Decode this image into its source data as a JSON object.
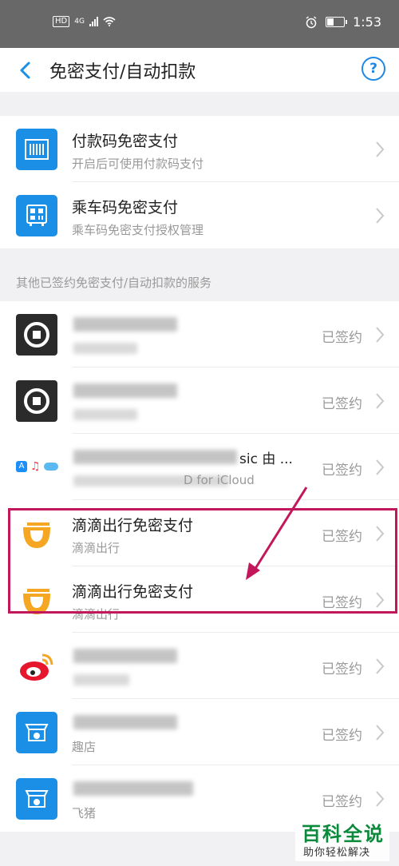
{
  "status_bar": {
    "hd": "HD",
    "network": "4G",
    "time": "1:53"
  },
  "header": {
    "title": "免密支付/自动扣款",
    "help": "?"
  },
  "top_items": [
    {
      "title": "付款码免密支付",
      "subtitle": "开启后可使用付款码支付",
      "icon": "barcode-icon"
    },
    {
      "title": "乘车码免密支付",
      "subtitle": "乘车码免密支付授权管理",
      "icon": "bus-code-icon"
    }
  ],
  "section_label": "其他已签约免密支付/自动扣款的服务",
  "services": [
    {
      "title": "",
      "subtitle": "",
      "status": "已签约",
      "icon": "uber-icon"
    },
    {
      "title": "",
      "subtitle": "",
      "status": "已签约",
      "icon": "uber-icon"
    },
    {
      "title": "sic 由 ...",
      "subtitle": "D for iCloud",
      "status": "已签约",
      "icon": "apple-services-icon"
    },
    {
      "title": "滴滴出行免密支付",
      "subtitle": "滴滴出行",
      "status": "已签约",
      "icon": "didi-icon"
    },
    {
      "title": "滴滴出行免密支付",
      "subtitle": "滴滴出行",
      "status": "已签约",
      "icon": "didi-icon"
    },
    {
      "title": "",
      "subtitle": "",
      "status": "已签约",
      "icon": "weibo-icon"
    },
    {
      "title": "",
      "subtitle": "趣店",
      "status": "已签约",
      "icon": "qudian-icon"
    },
    {
      "title": "",
      "subtitle": "飞猪",
      "status": "已签约",
      "icon": "fliggy-icon"
    }
  ],
  "watermark": {
    "main": "百科全说",
    "sub": "助你轻松解决"
  },
  "colors": {
    "accent": "#1b8fe6",
    "highlight": "#c2185b",
    "didi": "#f5a623"
  }
}
